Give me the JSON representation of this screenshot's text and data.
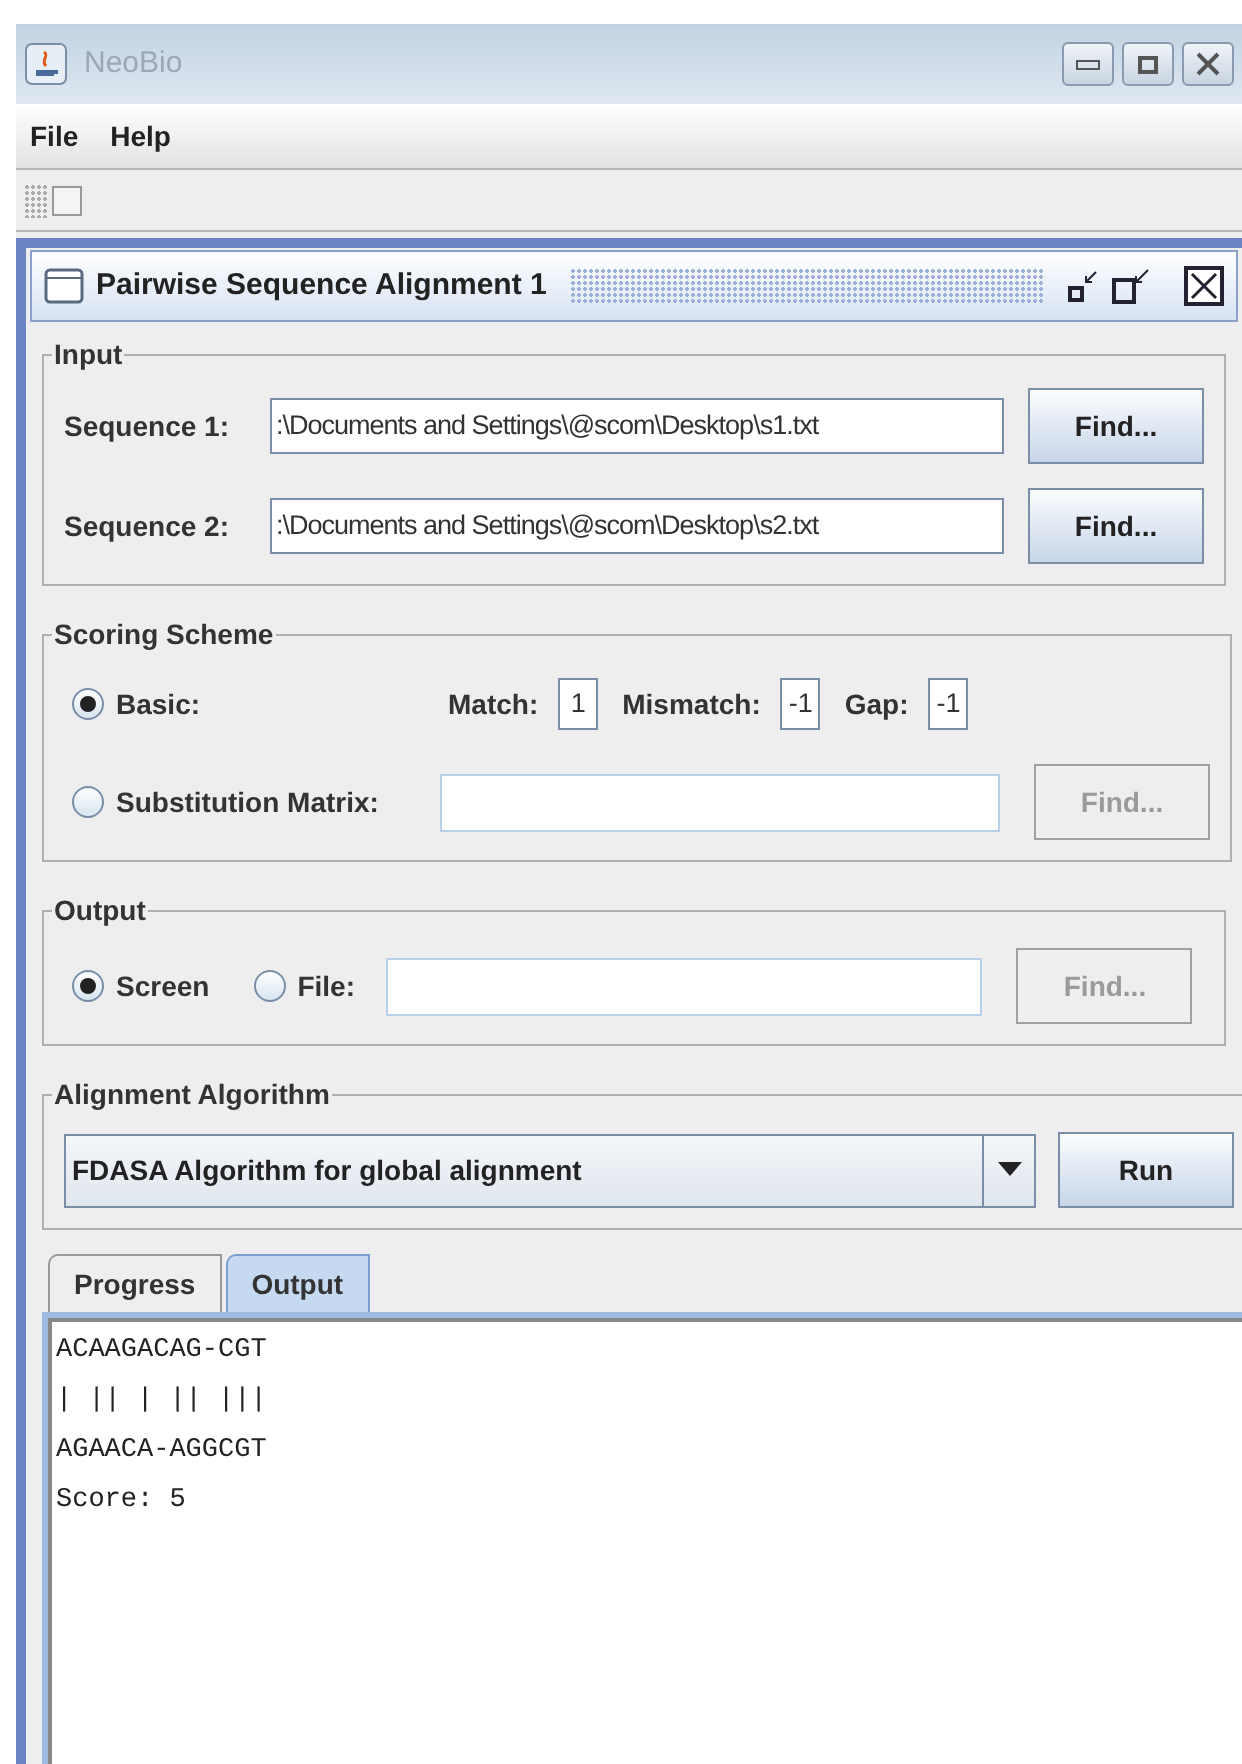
{
  "window": {
    "title": "NeoBio"
  },
  "menu": [
    {
      "label": "File"
    },
    {
      "label": "Help"
    }
  ],
  "internal_frame": {
    "title": "Pairwise Sequence Alignment 1"
  },
  "input": {
    "title": "Input",
    "sequences": [
      {
        "label": "Sequence 1:",
        "value": ":\\Documents and Settings\\@scom\\Desktop\\s1.txt",
        "button": "Find..."
      },
      {
        "label": "Sequence 2:",
        "value": ":\\Documents and Settings\\@scom\\Desktop\\s2.txt",
        "button": "Find..."
      }
    ]
  },
  "scoring": {
    "title": "Scoring Scheme",
    "options": [
      {
        "label": "Basic:",
        "selected": true
      },
      {
        "label": "Substitution Matrix:",
        "selected": false
      }
    ],
    "params": [
      {
        "label": "Match:",
        "value": "1"
      },
      {
        "label": "Mismatch:",
        "value": "-1"
      },
      {
        "label": "Gap:",
        "value": "-1"
      }
    ],
    "matrix_button": {
      "label": "Find...",
      "disabled": true
    }
  },
  "output": {
    "title": "Output",
    "options": [
      {
        "label": "Screen",
        "selected": true
      },
      {
        "label": "File:",
        "selected": false
      }
    ],
    "button": {
      "label": "Find...",
      "disabled": true
    }
  },
  "algorithm": {
    "title": "Alignment Algorithm",
    "value": "FDASA Algorithm for global alignment",
    "run": "Run"
  },
  "tabs": [
    {
      "label": "Progress",
      "selected": false
    },
    {
      "label": "Output",
      "selected": true
    }
  ],
  "result_lines": [
    "ACAAGACAG-CGT",
    "| || | || |||",
    "AGAACA-AGGCGT",
    "Score: 5"
  ]
}
